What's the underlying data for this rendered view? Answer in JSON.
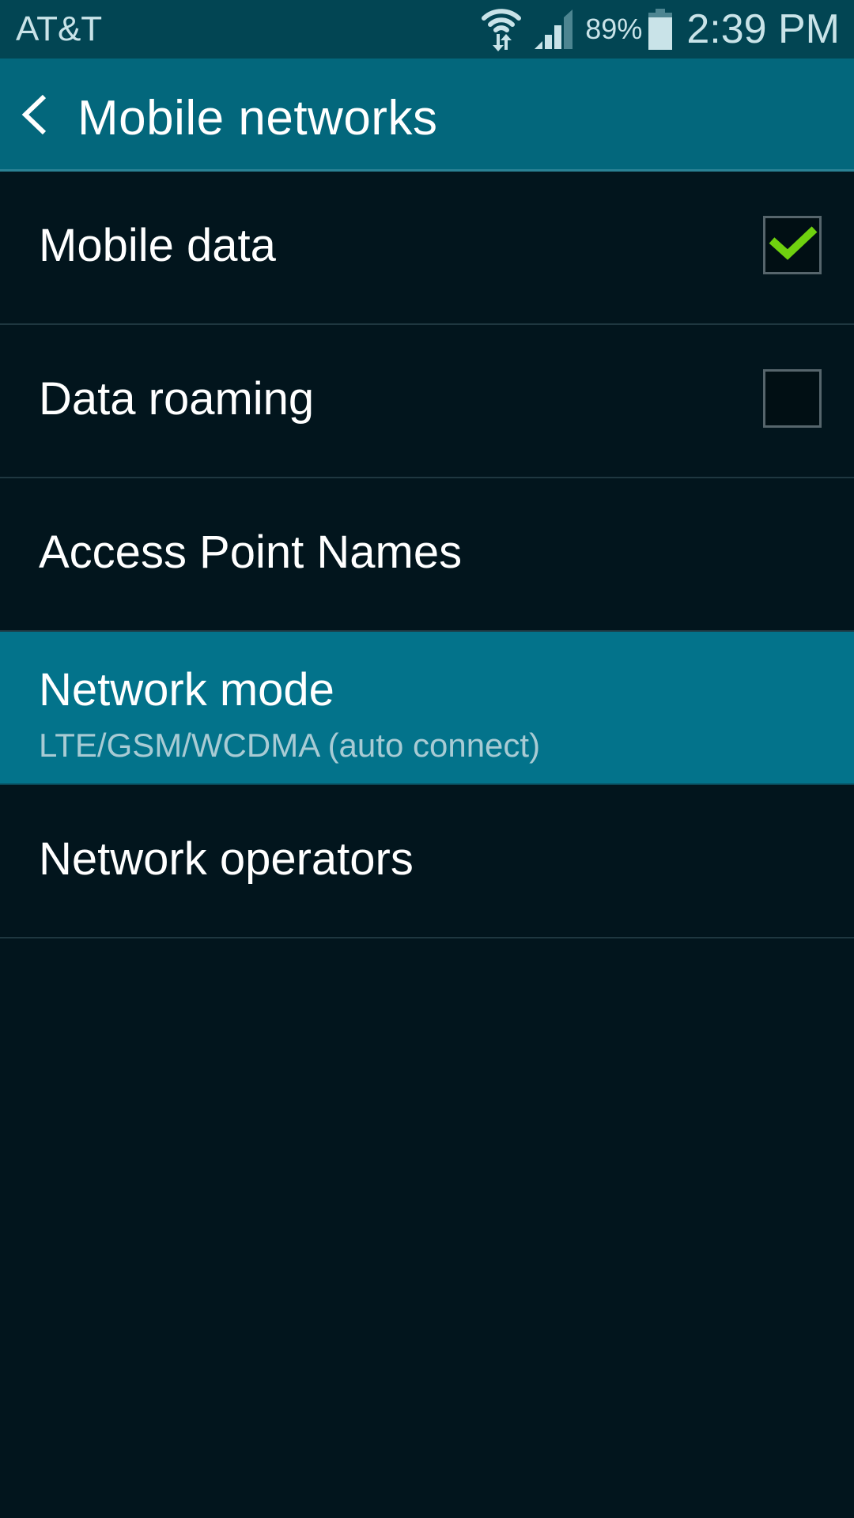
{
  "status_bar": {
    "carrier": "AT&T",
    "wifi_icon": "wifi-data-transfer-icon",
    "signal_icon": "cellular-signal-icon",
    "battery_percent": "89%",
    "battery_icon": "battery-icon",
    "time": "2:39 PM"
  },
  "action_bar": {
    "back_icon": "chevron-left-icon",
    "title": "Mobile networks"
  },
  "settings": [
    {
      "label": "Mobile data",
      "type": "checkbox",
      "checked": true
    },
    {
      "label": "Data roaming",
      "type": "checkbox",
      "checked": false
    },
    {
      "label": "Access Point Names",
      "type": "link"
    },
    {
      "label": "Network mode",
      "summary": "LTE/GSM/WCDMA (auto connect)",
      "type": "link",
      "selected": true
    },
    {
      "label": "Network operators",
      "type": "link"
    }
  ],
  "colors": {
    "status_bar_bg": "#024553",
    "action_bar_bg": "#03677c",
    "background": "#02151d",
    "selected_row_bg": "#03738b",
    "checkmark": "#6fd10f",
    "text_primary": "#ffffff",
    "text_secondary": "#a8cbd4"
  }
}
